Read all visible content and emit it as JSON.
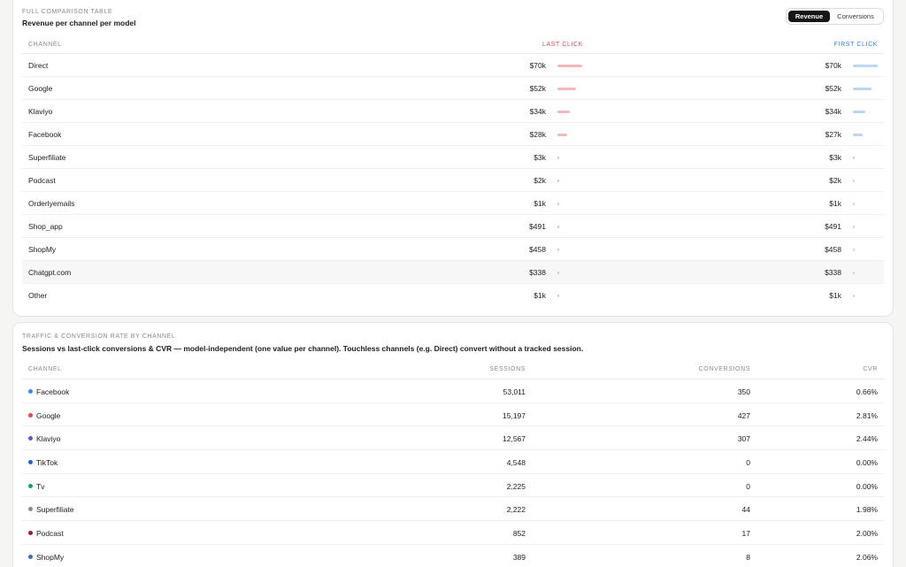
{
  "comparison": {
    "eyebrow": "FULL COMPARISON TABLE",
    "subtitle": "Revenue per channel per model",
    "toggle": {
      "active": "Revenue",
      "inactive": "Conversions"
    },
    "headers": {
      "channel": "CHANNEL",
      "last_click": "LAST CLICK",
      "first_click": "FIRST CLICK"
    },
    "colors": {
      "last_click": "#e5484d",
      "first_click": "#2f80d1",
      "last_bar": "#f2b8b8",
      "first_bar": "#bcd6f0"
    },
    "rows": [
      {
        "channel": "Direct",
        "last": "$70k",
        "first": "$70k",
        "last_fill": 1.0,
        "first_fill": 1.0
      },
      {
        "channel": "Google",
        "last": "$52k",
        "first": "$52k",
        "last_fill": 0.74,
        "first_fill": 0.74
      },
      {
        "channel": "Klaviyo",
        "last": "$34k",
        "first": "$34k",
        "last_fill": 0.49,
        "first_fill": 0.49
      },
      {
        "channel": "Facebook",
        "last": "$28k",
        "first": "$27k",
        "last_fill": 0.4,
        "first_fill": 0.39
      },
      {
        "channel": "Superfiliate",
        "last": "$3k",
        "first": "$3k",
        "last_fill": 0.04,
        "first_fill": 0.04
      },
      {
        "channel": "Podcast",
        "last": "$2k",
        "first": "$2k",
        "last_fill": 0.03,
        "first_fill": 0.03
      },
      {
        "channel": "Orderlyemails",
        "last": "$1k",
        "first": "$1k",
        "last_fill": 0.02,
        "first_fill": 0.02
      },
      {
        "channel": "Shop_app",
        "last": "$491",
        "first": "$491",
        "last_fill": 0.01,
        "first_fill": 0.01
      },
      {
        "channel": "ShopMy",
        "last": "$458",
        "first": "$458",
        "last_fill": 0.01,
        "first_fill": 0.01
      },
      {
        "channel": "Chatgpt.com",
        "last": "$338",
        "first": "$338",
        "last_fill": 0.005,
        "first_fill": 0.005
      },
      {
        "channel": "Other",
        "last": "$1k",
        "first": "$1k",
        "last_fill": 0.02,
        "first_fill": 0.02
      }
    ]
  },
  "traffic": {
    "eyebrow": "TRAFFIC & CONVERSION RATE BY CHANNEL",
    "subtitle": "Sessions vs last-click conversions & CVR — model-independent (one value per channel). Touchless channels (e.g. Direct) convert without a tracked session.",
    "headers": {
      "channel": "CHANNEL",
      "sessions": "SESSIONS",
      "conversions": "CONVERSIONS",
      "cvr": "CVR"
    },
    "rows": [
      {
        "channel": "Facebook",
        "color": "#3b82f6",
        "sessions": "53,011",
        "conversions": "350",
        "cvr": "0.66%"
      },
      {
        "channel": "Google",
        "color": "#e5484d",
        "sessions": "15,197",
        "conversions": "427",
        "cvr": "2.81%"
      },
      {
        "channel": "Klaviyo",
        "color": "#6d4fd0",
        "sessions": "12,567",
        "conversions": "307",
        "cvr": "2.44%"
      },
      {
        "channel": "TikTok",
        "color": "#2563c9",
        "sessions": "4,548",
        "conversions": "0",
        "cvr": "0.00%"
      },
      {
        "channel": "Tv",
        "color": "#16a36a",
        "sessions": "2,225",
        "conversions": "0",
        "cvr": "0.00%"
      },
      {
        "channel": "Superfiliate",
        "color": "#8a8a8a",
        "sessions": "2,222",
        "conversions": "44",
        "cvr": "1.98%"
      },
      {
        "channel": "Podcast",
        "color": "#9f1d3a",
        "sessions": "852",
        "conversions": "17",
        "cvr": "2.00%"
      },
      {
        "channel": "ShopMy",
        "color": "#2f6fd0",
        "sessions": "389",
        "conversions": "8",
        "cvr": "2.06%"
      }
    ]
  }
}
